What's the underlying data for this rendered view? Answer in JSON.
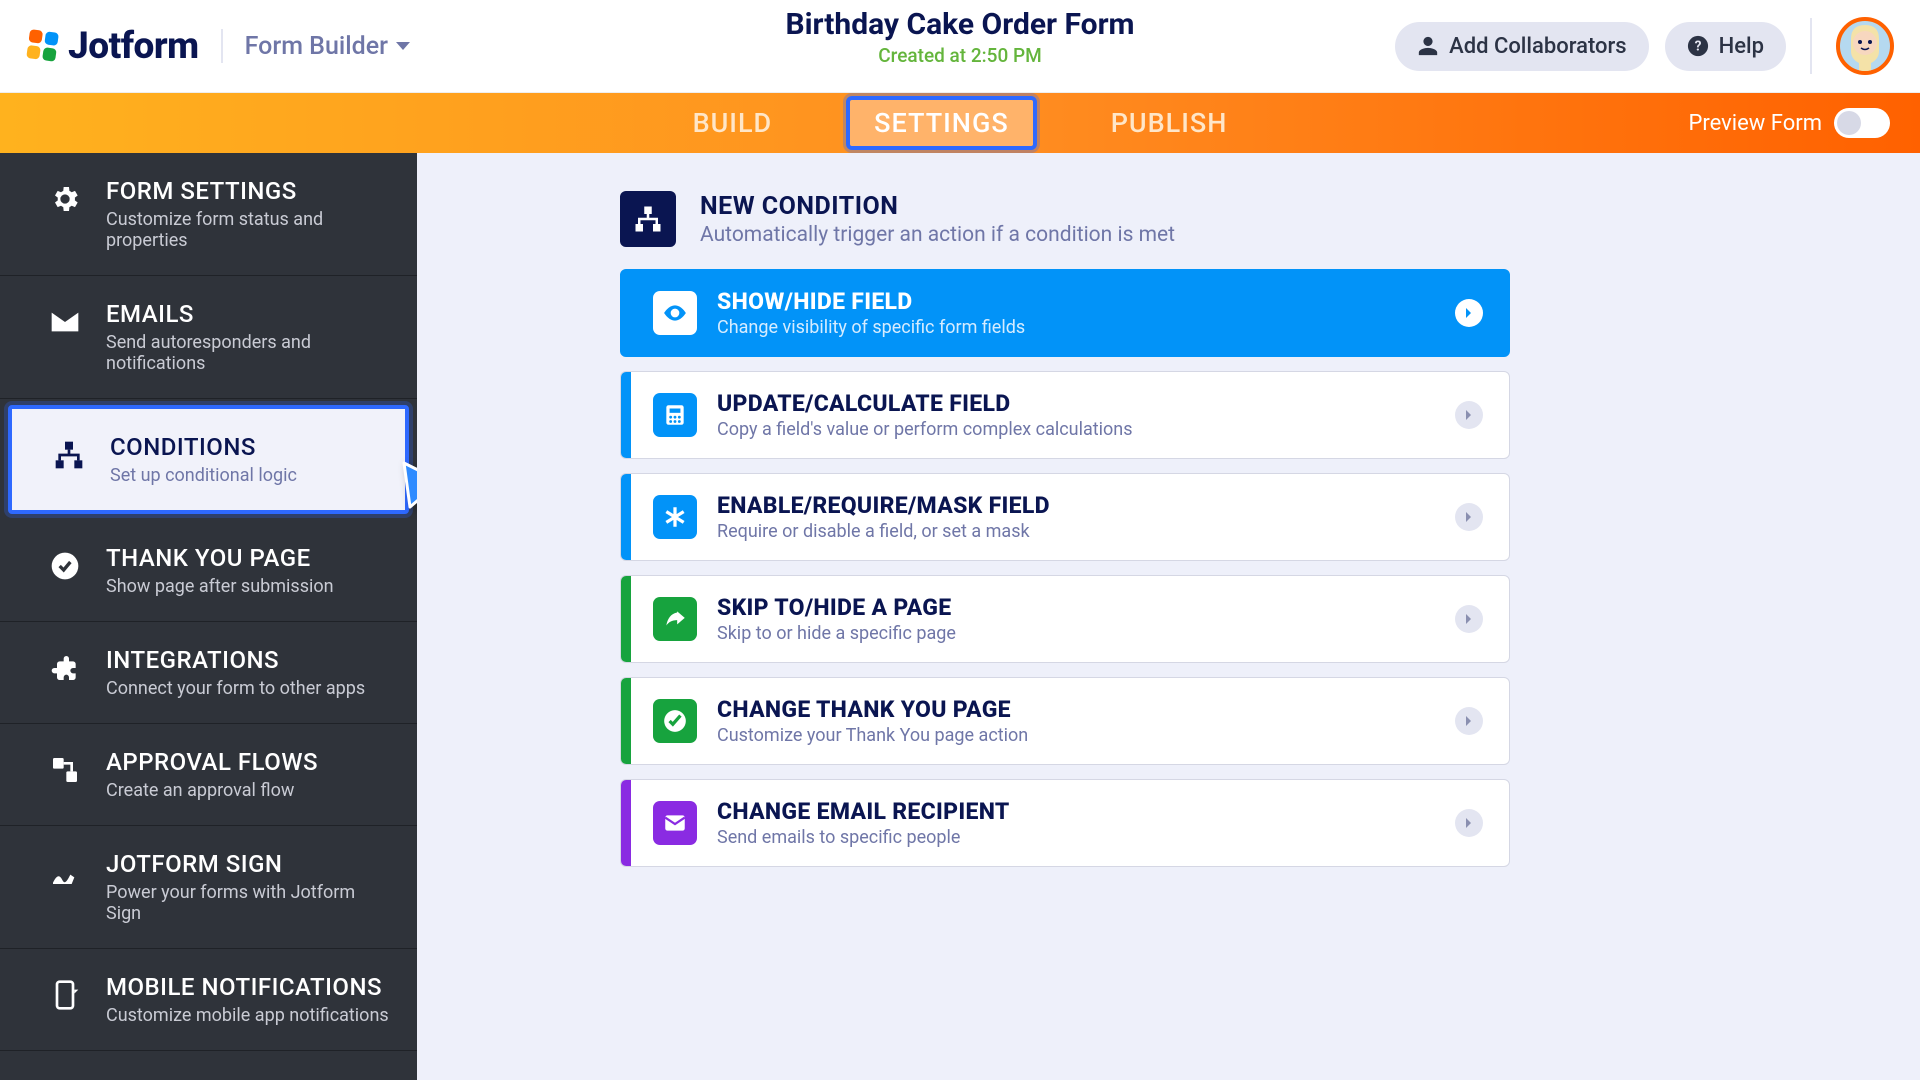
{
  "header": {
    "logo_text": "Jotform",
    "form_builder": "Form Builder",
    "title": "Birthday Cake Order Form",
    "created": "Created at 2:50 PM",
    "collab": "Add Collaborators",
    "help": "Help"
  },
  "nav": {
    "build": "BUILD",
    "settings": "SETTINGS",
    "publish": "PUBLISH",
    "preview": "Preview Form"
  },
  "sidebar": {
    "items": [
      {
        "title": "FORM SETTINGS",
        "sub": "Customize form status and properties"
      },
      {
        "title": "EMAILS",
        "sub": "Send autoresponders and notifications"
      },
      {
        "title": "CONDITIONS",
        "sub": "Set up conditional logic"
      },
      {
        "title": "THANK YOU PAGE",
        "sub": "Show page after submission"
      },
      {
        "title": "INTEGRATIONS",
        "sub": "Connect your form to other apps"
      },
      {
        "title": "APPROVAL FLOWS",
        "sub": "Create an approval flow"
      },
      {
        "title": "JOTFORM SIGN",
        "sub": "Power your forms with Jotform Sign"
      },
      {
        "title": "MOBILE NOTIFICATIONS",
        "sub": "Customize mobile app notifications"
      }
    ]
  },
  "main": {
    "heading": "NEW CONDITION",
    "subheading": "Automatically trigger an action if a condition is met",
    "rows": [
      {
        "title": "SHOW/HIDE FIELD",
        "sub": "Change visibility of specific form fields"
      },
      {
        "title": "UPDATE/CALCULATE FIELD",
        "sub": "Copy a field's value or perform complex calculations"
      },
      {
        "title": "ENABLE/REQUIRE/MASK FIELD",
        "sub": "Require or disable a field, or set a mask"
      },
      {
        "title": "SKIP TO/HIDE A PAGE",
        "sub": "Skip to or hide a specific page"
      },
      {
        "title": "CHANGE THANK YOU PAGE",
        "sub": "Customize your Thank You page action"
      },
      {
        "title": "CHANGE EMAIL RECIPIENT",
        "sub": "Send emails to specific people"
      }
    ]
  }
}
